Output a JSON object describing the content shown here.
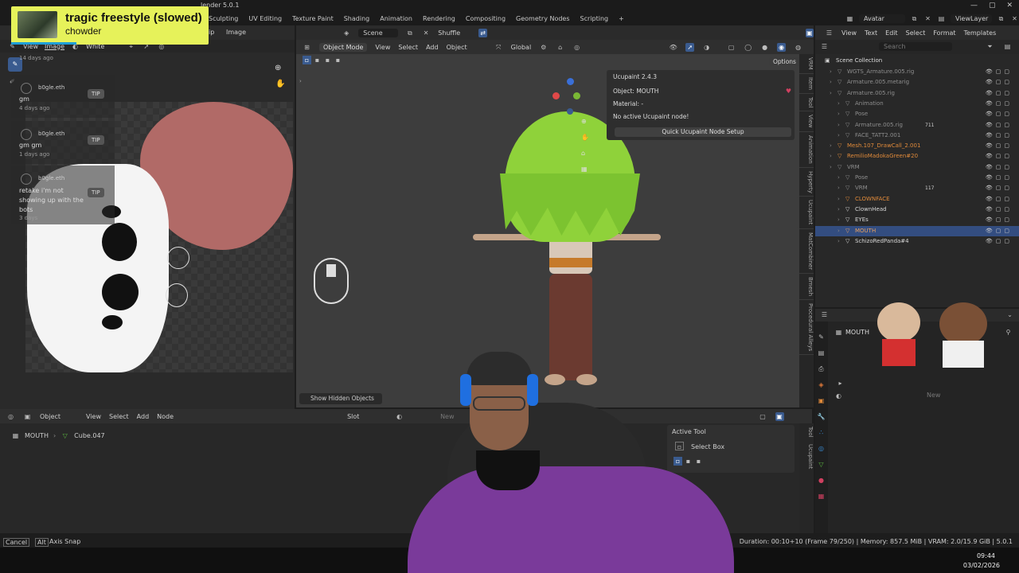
{
  "app": {
    "title": "Blender 5.0.1",
    "title_fragment": "lender 5.0.1"
  },
  "music": {
    "song": "tragic freestyle (slowed)",
    "artist": "chowder",
    "progress": 0.33
  },
  "workspaces": [
    "Sculpting",
    "UV Editing",
    "Texture Paint",
    "Shading",
    "Animation",
    "Rendering",
    "Compositing",
    "Geometry Nodes",
    "Scripting",
    "+"
  ],
  "top_right": {
    "scene_object": "Avatar",
    "view_layer": "ViewLayer"
  },
  "image_editor": {
    "header_items": [
      "ip",
      "Image"
    ],
    "tools": [
      "View",
      "Image",
      "White"
    ],
    "chat": [
      {
        "time_above": "14 days ago",
        "user": "b0gle.eth",
        "msg": "gm",
        "time": "4 days ago",
        "tip": "TIP"
      },
      {
        "user": "b0gle.eth",
        "msg": "gm gm",
        "time": "1 days ago",
        "tip": "TIP"
      },
      {
        "user": "b0gle.eth",
        "msg": "retake i'm not showing up with the bots",
        "time": "3 days",
        "tip": "TIP"
      }
    ]
  },
  "viewport_top": {
    "scene": "Scene",
    "shuffle": "Shuffle"
  },
  "viewport_header": {
    "mode": "Object Mode",
    "menus": [
      "View",
      "Select",
      "Add",
      "Object"
    ],
    "orientation": "Global",
    "options": "Options"
  },
  "ucupaint": {
    "title": "Ucupaint 2.4.3",
    "object": "Object: MOUTH",
    "material": "Material: -",
    "warning": "No active Ucupaint node!",
    "button": "Quick Ucupaint Node Setup"
  },
  "viewport_side_tabs": [
    "VRM",
    "Item",
    "Tool",
    "View",
    "Animation",
    "Hyperty",
    "Ucupaint",
    "MatCombiner",
    "Bmesh",
    "Procedural Alleys"
  ],
  "show_hidden_objects": "Show Hidden Objects",
  "text_editor_menu": [
    "View",
    "Text",
    "Edit",
    "Select",
    "Format",
    "Templates"
  ],
  "outliner": {
    "search_placeholder": "Search",
    "collection": "Scene Collection",
    "rows": [
      {
        "name": "WGTS_Armature.005.rig",
        "indent": 1,
        "color": "#8e8e8e"
      },
      {
        "name": "Armature.005.metarig",
        "indent": 1,
        "color": "#8e8e8e"
      },
      {
        "name": "Armature.005.rig",
        "indent": 1,
        "color": "#8e8e8e"
      },
      {
        "name": "Animation",
        "indent": 2,
        "color": "#8e8e8e"
      },
      {
        "name": "Pose",
        "indent": 2,
        "color": "#8e8e8e"
      },
      {
        "name": "Armature.005.rig",
        "indent": 2,
        "color": "#8e8e8e",
        "badge": "711"
      },
      {
        "name": "FACE_TATT2.001",
        "indent": 2,
        "color": "#8e8e8e"
      },
      {
        "name": "Mesh.107_DrawCall_2.001",
        "indent": 1,
        "color": "#e08a3a"
      },
      {
        "name": "RemilioMadokaGreen#20",
        "indent": 1,
        "color": "#e08a3a"
      },
      {
        "name": "VRM",
        "indent": 1,
        "color": "#8e8e8e"
      },
      {
        "name": "Pose",
        "indent": 2,
        "color": "#8e8e8e"
      },
      {
        "name": "VRM",
        "indent": 2,
        "color": "#8e8e8e",
        "badge": "117"
      },
      {
        "name": "CLOWNFACE",
        "indent": 2,
        "color": "#e08a3a"
      },
      {
        "name": "ClownHead",
        "indent": 2,
        "color": "#d6d6d6"
      },
      {
        "name": "EYEs",
        "indent": 2,
        "color": "#d6d6d6"
      },
      {
        "name": "MOUTH",
        "indent": 2,
        "color": "#e8a060",
        "selected": true
      },
      {
        "name": "SchizoRedPanda#4",
        "indent": 2,
        "color": "#d6d6d6"
      }
    ]
  },
  "properties": {
    "object": "MOUTH",
    "new_button": "New"
  },
  "node_editor": {
    "type": "Object",
    "menus": [
      "View",
      "Select",
      "Add",
      "Node"
    ],
    "slot": "Slot",
    "new": "New",
    "breadcrumb_object": "MOUTH",
    "breadcrumb_mesh": "Cube.047",
    "side_tabs": [
      "Tool",
      "Ucupaint"
    ],
    "active_tool_title": "Active Tool",
    "active_tool": "Select Box"
  },
  "statusbar": {
    "cancel": "Cancel",
    "alt": "Alt",
    "axis_snap": "Axis Snap",
    "info": "Duration: 00:10+10 (Frame 79/250) | Memory: 857.5 MiB | VRAM: 2.0/15.9 GiB | 5.0.1"
  },
  "clock": {
    "time": "09:44",
    "date": "03/02/2026"
  },
  "colors": {
    "accent": "#334d80",
    "music_bg": "#e6f25a",
    "hair": "#8fd23a",
    "mouth_uv": "#b16a67"
  }
}
